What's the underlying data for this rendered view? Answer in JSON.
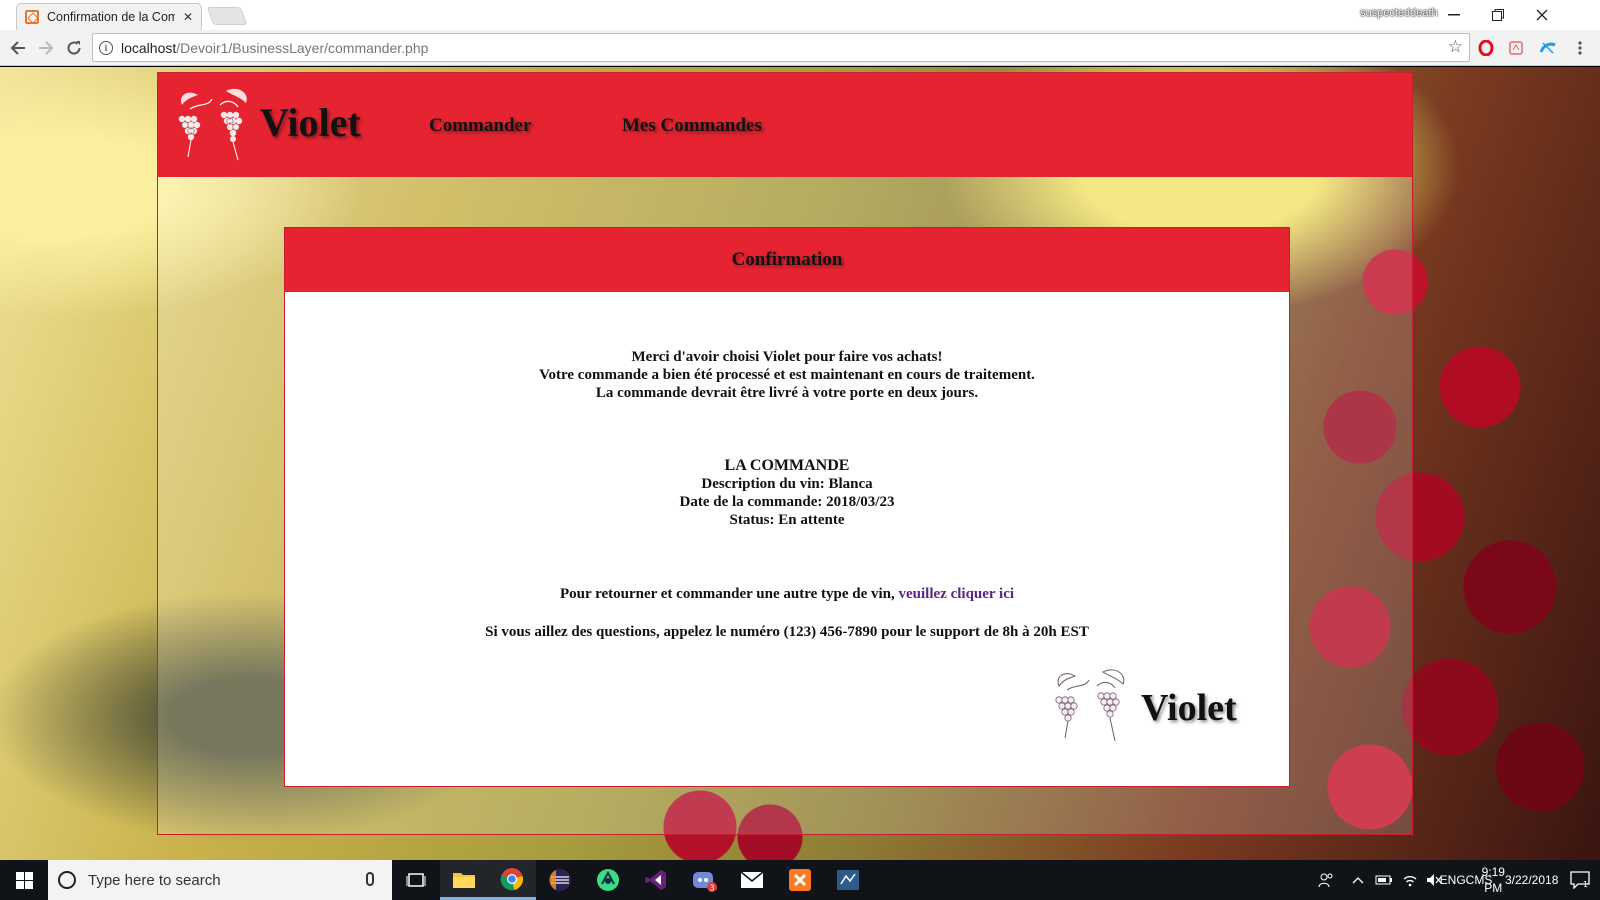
{
  "browser": {
    "tab_title": "Confirmation de la Commande",
    "tab_close": "✕",
    "profile_name": "suspecteddeath",
    "url_host": "localhost",
    "url_path": "/Devoir1/BusinessLayer/commander.php",
    "icons": [
      "back-icon",
      "forward-icon",
      "reload-icon",
      "info-icon",
      "star-icon",
      "opera-icon",
      "pdf-icon",
      "extension-icon",
      "menu-icon"
    ]
  },
  "site": {
    "name": "Violet",
    "nav": [
      "Commander",
      "Mes Commandes"
    ],
    "brand_color": "#e62431"
  },
  "confirmation": {
    "title": "Confirmation",
    "thanks_lines": [
      "Merci d'avoir choisi Violet pour faire vos achats!",
      "Votre commande a bien été processé et est maintenant en cours de traitement.",
      "La commande devrait être livré à votre porte en deux jours."
    ],
    "order_title": "LA COMMANDE",
    "order_lines": [
      "Description du vin: Blanca",
      "Date de la commande: 2018/03/23",
      "Status: En attente"
    ],
    "return_text": "Pour retourner et commander une autre type de vin,",
    "return_link": "veuillez cliquer ici",
    "support_text": "Si vous aillez des questions, appelez le numéro (123) 456-7890 pour le support de 8h à 20h EST",
    "footer_logo": "Violet"
  },
  "taskbar": {
    "search_placeholder": "Type here to search",
    "apps": [
      "task-view-icon",
      "file-explorer-icon",
      "chrome-icon",
      "eclipse-icon",
      "android-studio-icon",
      "visual-studio-icon",
      "discord-icon",
      "mail-icon",
      "xampp-icon",
      "ssms-icon"
    ],
    "discord_badge": "3",
    "lang_top": "ENG",
    "lang_bottom": "CMS",
    "time": "9:19 PM",
    "date": "3/22/2018",
    "notification_count": "1"
  }
}
